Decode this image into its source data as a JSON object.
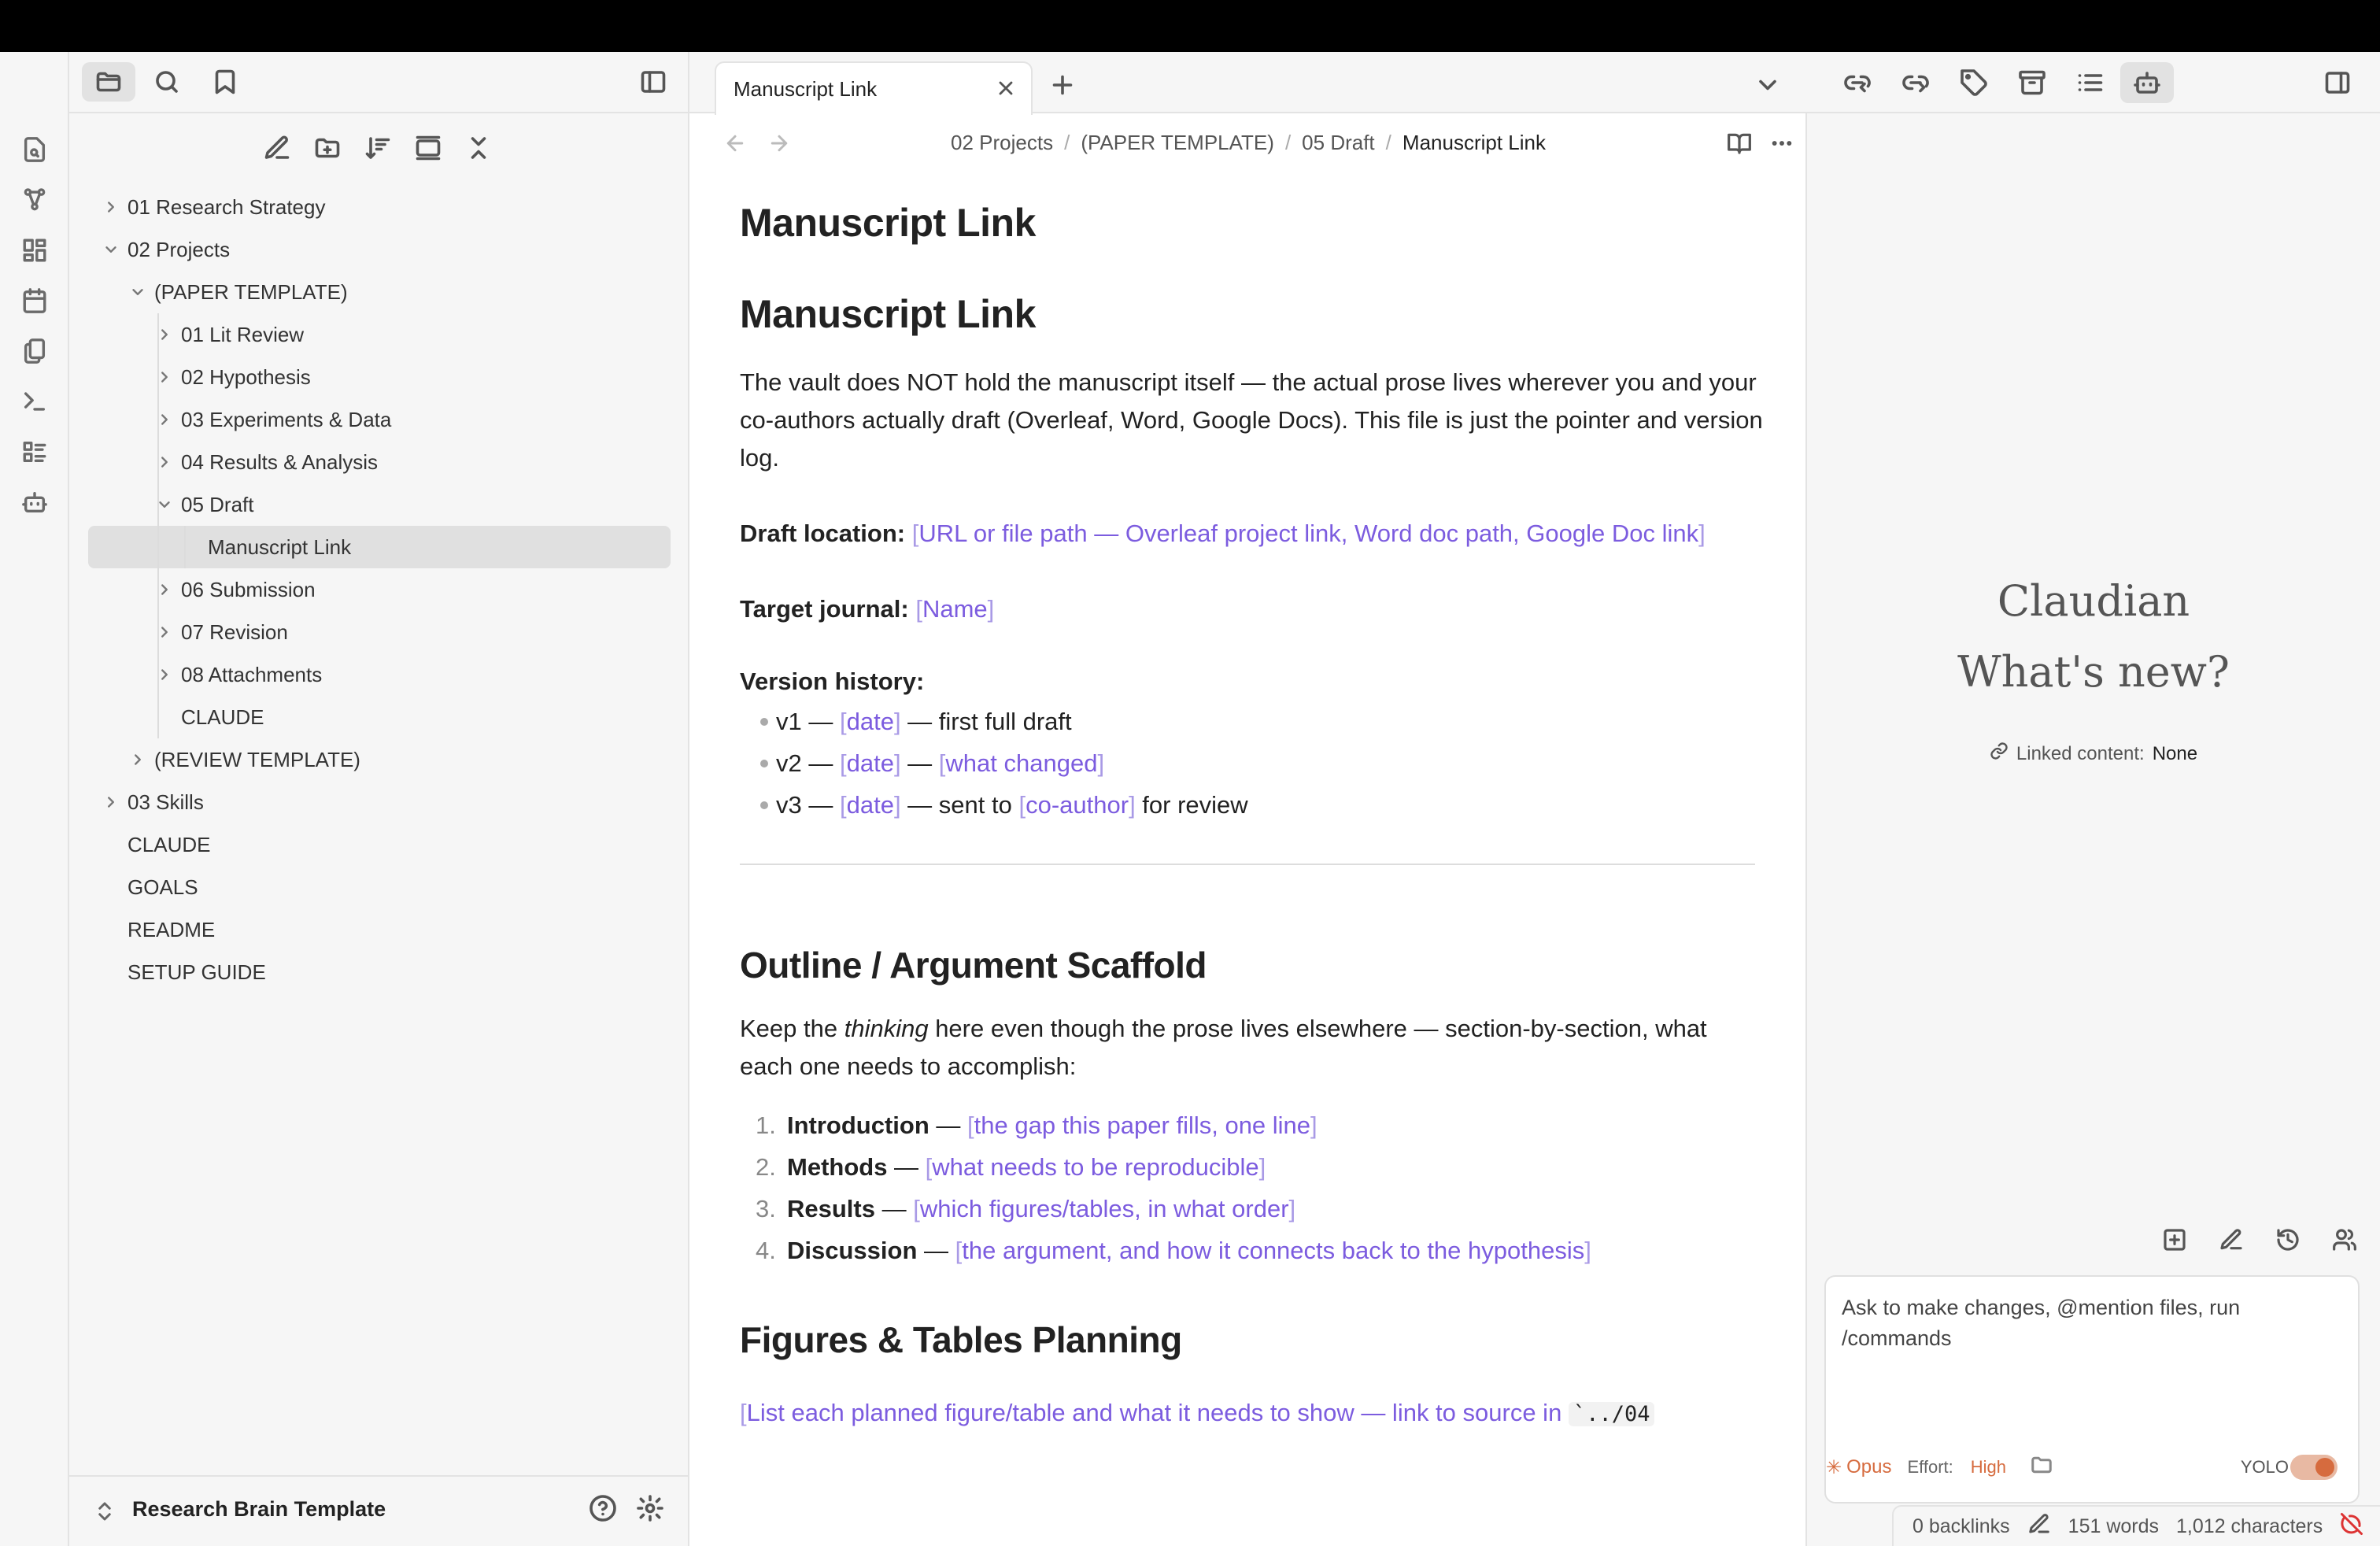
{
  "sidebar": {
    "tree": [
      {
        "label": "01 Research Strategy",
        "depth": 0,
        "chevron": "right"
      },
      {
        "label": "02 Projects",
        "depth": 0,
        "chevron": "down"
      },
      {
        "label": "(PAPER TEMPLATE)",
        "depth": 1,
        "chevron": "down"
      },
      {
        "label": "01 Lit Review",
        "depth": 2,
        "chevron": "right"
      },
      {
        "label": "02 Hypothesis",
        "depth": 2,
        "chevron": "right"
      },
      {
        "label": "03 Experiments & Data",
        "depth": 2,
        "chevron": "right"
      },
      {
        "label": "04 Results & Analysis",
        "depth": 2,
        "chevron": "right"
      },
      {
        "label": "05 Draft",
        "depth": 2,
        "chevron": "down"
      },
      {
        "label": "Manuscript Link",
        "depth": 3,
        "chevron": "none",
        "selected": true
      },
      {
        "label": "06 Submission",
        "depth": 2,
        "chevron": "right"
      },
      {
        "label": "07 Revision",
        "depth": 2,
        "chevron": "right"
      },
      {
        "label": "08 Attachments",
        "depth": 2,
        "chevron": "right"
      },
      {
        "label": "CLAUDE",
        "depth": 2,
        "chevron": "none"
      },
      {
        "label": "(REVIEW TEMPLATE)",
        "depth": 1,
        "chevron": "right"
      },
      {
        "label": "03 Skills",
        "depth": 0,
        "chevron": "right"
      },
      {
        "label": "CLAUDE",
        "depth": 0,
        "chevron": "none"
      },
      {
        "label": "GOALS",
        "depth": 0,
        "chevron": "none"
      },
      {
        "label": "README",
        "depth": 0,
        "chevron": "none"
      },
      {
        "label": "SETUP GUIDE",
        "depth": 0,
        "chevron": "none"
      }
    ],
    "vault_name": "Research Brain Template"
  },
  "tab": {
    "title": "Manuscript Link"
  },
  "breadcrumb": [
    "02 Projects",
    "(PAPER TEMPLATE)",
    "05 Draft",
    "Manuscript Link"
  ],
  "doc": {
    "inline_title": "Manuscript Link",
    "h1": "Manuscript Link",
    "intro": "The vault does NOT hold the manuscript itself — the actual prose lives wherever you and your co-authors actually draft (Overleaf, Word, Google Docs). This file is just the pointer and version log.",
    "draft_location_label": "Draft location:",
    "draft_location_value": "URL or file path — Overleaf project link, Word doc path, Google Doc link",
    "target_journal_label": "Target journal:",
    "target_journal_value": "Name",
    "version_history_label": "Version history:",
    "versions": [
      {
        "v": "v1 — ",
        "date": "date",
        "mid": " — first full draft",
        "link": "",
        "tail": ""
      },
      {
        "v": "v2 — ",
        "date": "date",
        "mid": " — ",
        "link": "what changed",
        "tail": ""
      },
      {
        "v": "v3 — ",
        "date": "date",
        "mid": " — sent to ",
        "link": "co-author",
        "tail": " for review"
      }
    ],
    "outline_heading": "Outline / Argument Scaffold",
    "outline_intro_a": "Keep the ",
    "outline_intro_em": "thinking",
    "outline_intro_b": " here even though the prose lives elsewhere — section-by-section, what each one needs to accomplish:",
    "outline": [
      {
        "num": "1.",
        "name": "Introduction",
        "link": "the gap this paper fills, one line"
      },
      {
        "num": "2.",
        "name": "Methods",
        "link": "what needs to be reproducible"
      },
      {
        "num": "3.",
        "name": "Results",
        "link": "which figures/tables, in what order"
      },
      {
        "num": "4.",
        "name": "Discussion",
        "link": "the argument, and how it connects back to the hypothesis"
      }
    ],
    "figures_heading": "Figures & Tables Planning",
    "figures_text": "List each planned figure/table and what it needs to show — link to source in ",
    "figures_code": "`../04"
  },
  "claudian": {
    "title": "Claudian",
    "subtitle": "What's new?",
    "linked_label": "Linked content:",
    "linked_value": "None",
    "placeholder": "Ask to make changes, @mention files, run /commands",
    "model": "Opus",
    "effort_label": "Effort:",
    "effort_value": "High",
    "yolo_label": "YOLO",
    "yolo_on": true
  },
  "status": {
    "backlinks": "0 backlinks",
    "words": "151 words",
    "characters": "1,012 characters"
  },
  "colors": {
    "accent": "#7c5cdf",
    "claude_orange": "#d66b3e"
  }
}
